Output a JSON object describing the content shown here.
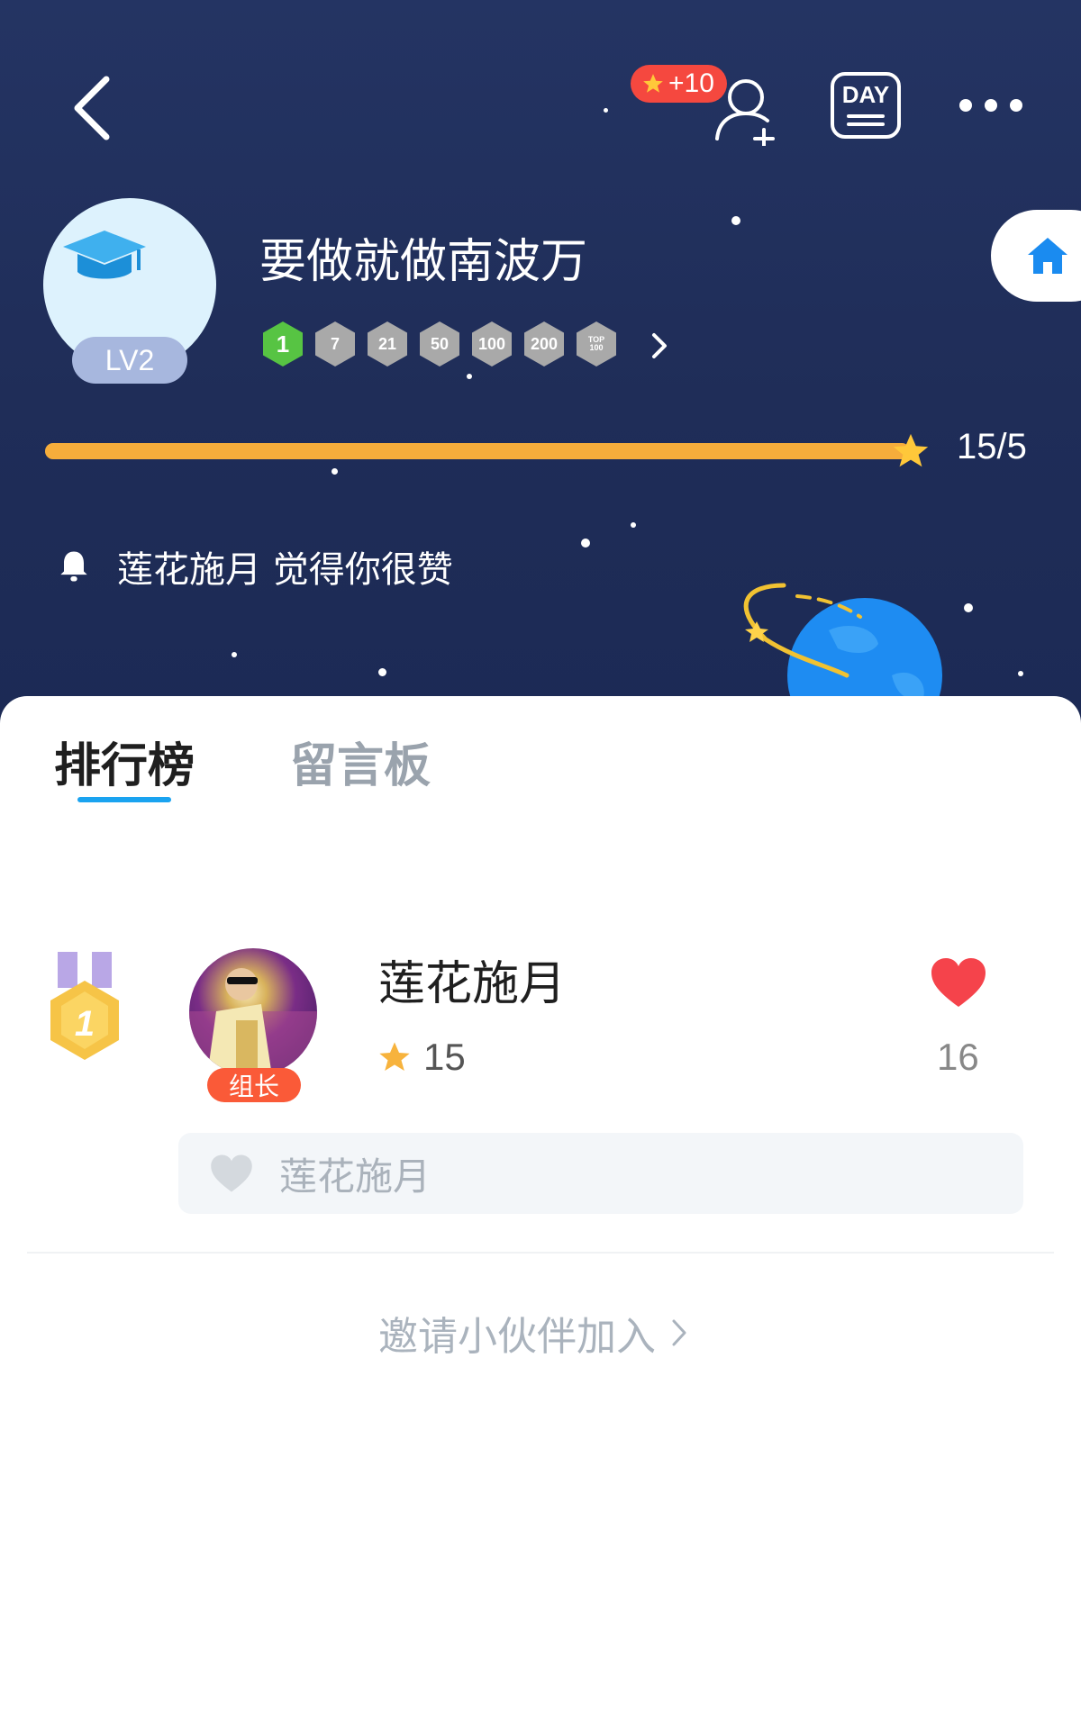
{
  "header": {
    "follow_bonus": "+10",
    "day_label": "DAY"
  },
  "group": {
    "name": "要做就做南波万",
    "level": "LV2",
    "badges": [
      "1",
      "7",
      "21",
      "50",
      "100",
      "200",
      "TOP 100"
    ],
    "badge_colors": [
      "#57c443",
      "#a9a9a9",
      "#a9a9a9",
      "#a9a9a9",
      "#a9a9a9",
      "#a9a9a9",
      "#a9a9a9"
    ],
    "progress_text": "15/5",
    "progress_fraction": 1.0
  },
  "notice": {
    "text": "莲花施月 觉得你很赞"
  },
  "tabs": [
    {
      "label": "排行榜",
      "active": true
    },
    {
      "label": "留言板",
      "active": false
    }
  ],
  "ranking": [
    {
      "rank": "1",
      "name": "莲花施月",
      "role": "组长",
      "score": "15",
      "likes": "16",
      "likers": "莲花施月"
    }
  ],
  "invite_label": "邀请小伙伴加入",
  "colors": {
    "hero_bg": "#243463",
    "progress": "#f6ad3b",
    "accent_blue": "#1aa3f0",
    "heart_red": "#f5434b",
    "leader_tag": "#fa5a38"
  }
}
